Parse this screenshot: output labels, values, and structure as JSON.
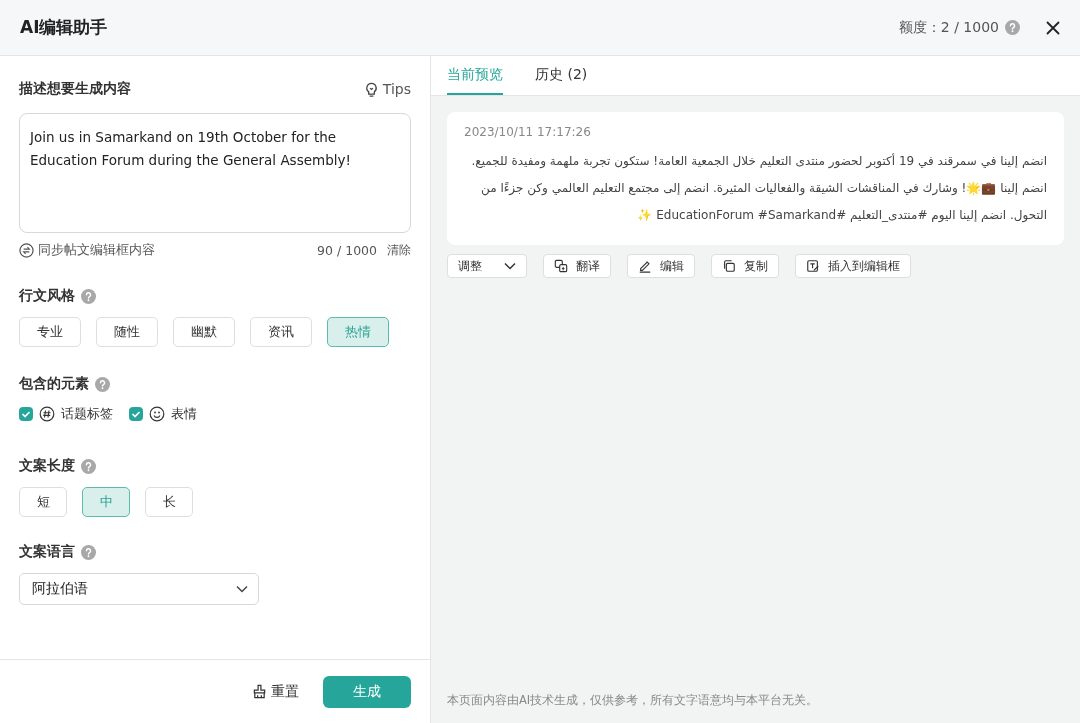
{
  "dialog": {
    "title": "AI编辑助手",
    "quota_label": "额度：",
    "quota_value": "2 / 1000"
  },
  "prompt": {
    "label": "描述想要生成内容",
    "tips": "Tips",
    "value": "Join us in Samarkand on 19th October for the Education Forum during the General Assembly!",
    "sync_label": "同步帖文编辑框内容",
    "char_count": "90 / 1000",
    "clear": "清除"
  },
  "style": {
    "label": "行文风格",
    "options": [
      {
        "label": "专业",
        "selected": false
      },
      {
        "label": "随性",
        "selected": false
      },
      {
        "label": "幽默",
        "selected": false
      },
      {
        "label": "资讯",
        "selected": false
      },
      {
        "label": "热情",
        "selected": true
      }
    ]
  },
  "elements": {
    "label": "包含的元素",
    "items": [
      {
        "kind": "hashtag",
        "label": "话题标签",
        "checked": true
      },
      {
        "kind": "emoji",
        "label": "表情",
        "checked": true
      }
    ]
  },
  "length": {
    "label": "文案长度",
    "options": [
      {
        "label": "短",
        "selected": false
      },
      {
        "label": "中",
        "selected": true
      },
      {
        "label": "长",
        "selected": false
      }
    ]
  },
  "language": {
    "label": "文案语言",
    "value": "阿拉伯语"
  },
  "footer": {
    "reset": "重置",
    "generate": "生成"
  },
  "tabs": [
    {
      "label": "当前预览",
      "selected": true
    },
    {
      "label": "历史 (2)",
      "selected": false
    }
  ],
  "result": {
    "timestamp": "2023/10/11 17:17:26",
    "text": "انضم إلينا في سمرقند في 19 أكتوبر لحضور منتدى التعليم خلال الجمعية العامة! ستكون تجربة ملهمة ومفيدة للجميع. انضم إلينا 💼🌟! وشارك في المناقشات الشيقة والفعاليات المثيرة. انضم إلى مجتمع التعليم العالمي وكن جزءًا من التحول. انضم إلينا اليوم #منتدى_التعليم #EducationForum #Samarkand ✨"
  },
  "actions": [
    {
      "kind": "dropdown",
      "label": "调整"
    },
    {
      "kind": "translate",
      "label": "翻译"
    },
    {
      "kind": "edit",
      "label": "编辑"
    },
    {
      "kind": "copy",
      "label": "复制"
    },
    {
      "kind": "insert",
      "label": "插入到编辑框"
    }
  ],
  "disclaimer": "本页面内容由AI技术生成，仅供参考，所有文字语意均与本平台无关。"
}
